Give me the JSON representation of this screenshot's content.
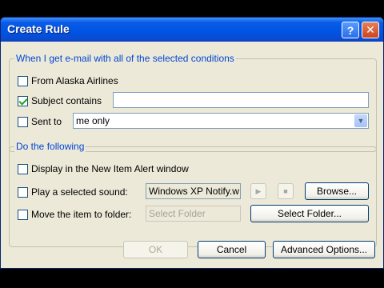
{
  "window": {
    "title": "Create Rule",
    "help_label": "?",
    "close_label": "✕"
  },
  "conditions": {
    "legend": "When I get e-mail with all of the selected conditions",
    "from": {
      "label": "From Alaska Airlines",
      "checked": false
    },
    "subject": {
      "label": "Subject contains",
      "checked": true,
      "value": ""
    },
    "sent_to": {
      "label": "Sent to",
      "checked": false,
      "value": "me only"
    }
  },
  "actions": {
    "legend": "Do the following",
    "alert": {
      "label": "Display in the New Item Alert window",
      "checked": false
    },
    "sound": {
      "label": "Play a selected sound:",
      "checked": false,
      "value": "Windows XP Notify.w",
      "play_icon": "play-icon",
      "stop_icon": "stop-icon",
      "browse_label": "Browse..."
    },
    "move": {
      "label": "Move the item to folder:",
      "checked": false,
      "placeholder": "Select Folder",
      "select_folder_label": "Select Folder..."
    }
  },
  "footer": {
    "ok_label": "OK",
    "cancel_label": "Cancel",
    "advanced_label": "Advanced Options..."
  },
  "colors": {
    "titlebar": "#0054e3",
    "dialog_bg": "#ece9d8",
    "legend_text": "#0046d5",
    "check_mark": "#21a121"
  }
}
